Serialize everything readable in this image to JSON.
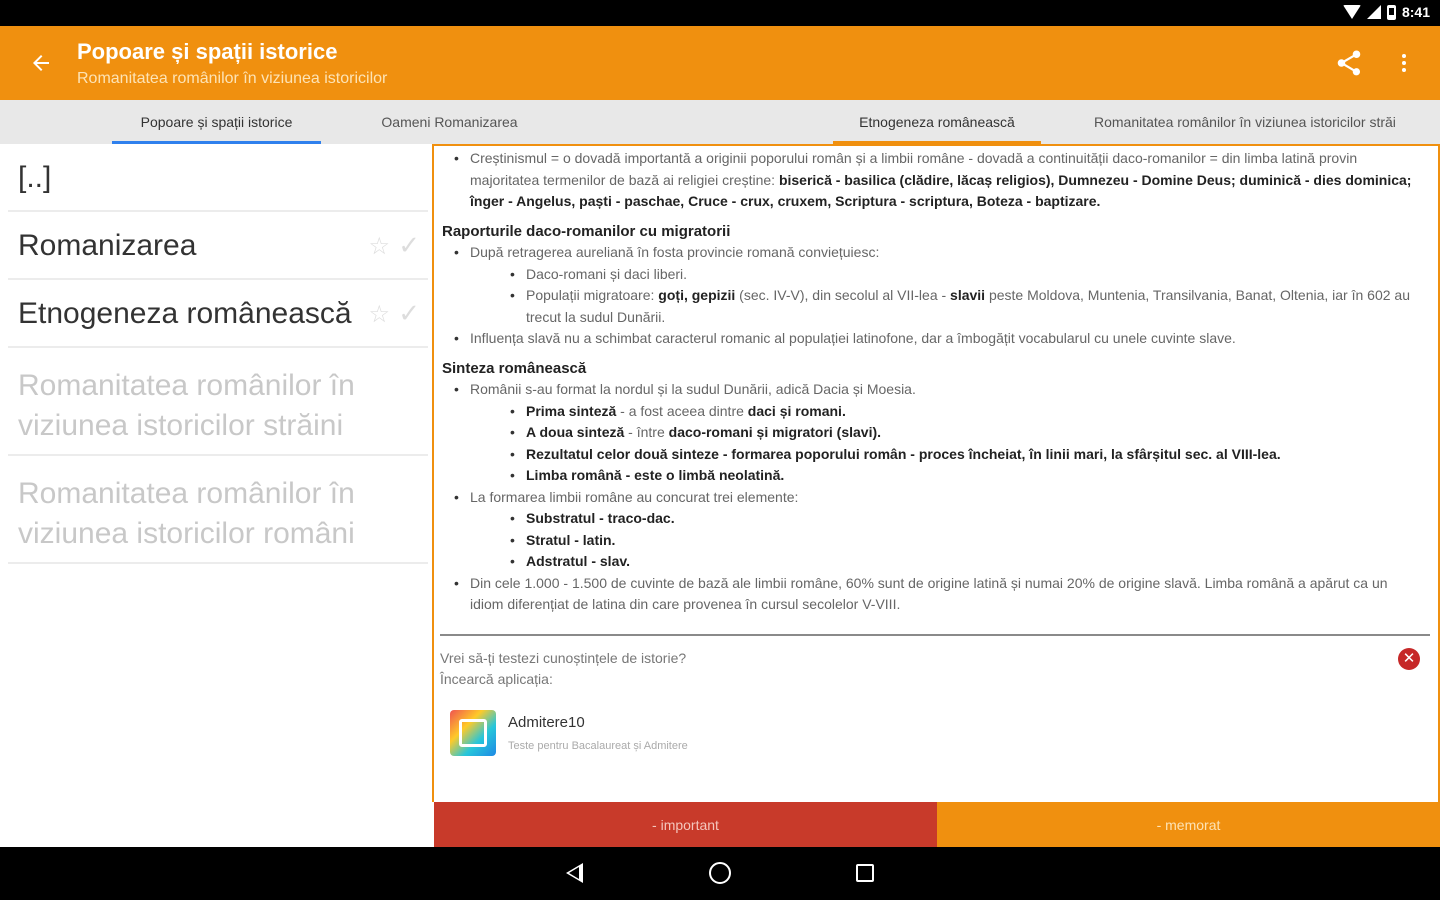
{
  "status_bar": {
    "time": "8:41"
  },
  "app_bar": {
    "title": "Popoare și spații istorice",
    "subtitle": "Romanitatea românilor în viziunea istoricilor",
    "accent_color": "#f0900f",
    "back_icon": "arrow-left-icon",
    "share_icon": "share-icon",
    "more_icon": "more-vert-icon"
  },
  "tabs": [
    {
      "label": "Popoare și spații istorice",
      "active": true,
      "indicator_color": "#2f80ed"
    },
    {
      "label": "Oameni Romanizarea",
      "active": false
    },
    {
      "label": "Etnogeneza românească",
      "active": true,
      "indicator_color": "#f0900f"
    },
    {
      "label": "Romanitatea românilor în viziunea istoricilor străi",
      "active": false
    }
  ],
  "list": {
    "items": [
      {
        "label": "[..]",
        "disabled": false
      },
      {
        "label": "Romanizarea",
        "disabled": false
      },
      {
        "label": "Etnogeneza românească",
        "disabled": false
      },
      {
        "label_line1": "Romanitatea românilor în",
        "label_line2": "viziunea istoricilor străini",
        "disabled": true
      },
      {
        "label_line1": "Romanitatea românilor în",
        "label_line2": "viziunea istoricilor români",
        "disabled": true
      }
    ]
  },
  "article": {
    "b1": {
      "t1": "Creștinismul = o dovadă importantă a originii poporului român și a limbii române - dovadă a continuității daco-romanilor = din limba latină provin majoritatea termenilor de bază ai religiei creștine: ",
      "b1": "biserică - basilica (clădire, lăcaș religios), Dumnezeu - Domine Deus; duminică - dies dominica; înger - Angelus, paști - paschae, Cruce - crux, cruxem, Scriptura - scriptura, Boteza - baptizare."
    },
    "h_rap": "Raporturile daco-romanilor cu migratorii",
    "r1": "După retragerea aureliană în fosta provincie romană conviețuiesc:",
    "r1a": "Daco-romani și daci liberi.",
    "r1b": {
      "t1": "Populații migratoare: ",
      "b1": "goți, gepizii",
      "t2": " (sec. IV-V), din secolul al VII-lea - ",
      "b2": "slavii",
      "t3": " peste Moldova, Muntenia, Transilvania, Banat, Oltenia, iar în 602 au trecut la sudul Dunării."
    },
    "r2": "Influența slavă nu a schimbat caracterul romanic al populației latinofone, dar a îmbogățit vocabularul cu unele cuvinte slave.",
    "h_sin": "Sinteza românească",
    "s1": "Românii s-au format la nordul și la sudul Dunării, adică Dacia și Moesia.",
    "s1a": {
      "b1": "Prima sinteză",
      "t1": " - a fost aceea dintre ",
      "b2": "daci și romani."
    },
    "s1b": {
      "b1": "A doua sinteză",
      "t1": " - între ",
      "b2": "daco-romani și migratori (slavi)."
    },
    "s1c": "Rezultatul celor două sinteze - formarea poporului român - proces încheiat, în linii mari, la sfârșitul sec. al VIII-lea.",
    "s1d": "Limba română - este o limbă neolatină.",
    "s2": "La formarea limbii române au concurat trei elemente:",
    "s2a": "Substratul - traco-dac.",
    "s2b": "Stratul - latin.",
    "s2c": "Adstratul - slav.",
    "s3": "Din cele 1.000 - 1.500 de cuvinte de bază ale limbii române, 60% sunt de origine latină și numai 20% de origine slavă. Limba română a apărut ca un idiom diferențiat de latina din care provenea în cursul secolelor V-VIII."
  },
  "promo": {
    "line1": "Vrei să-ți testezi cunoștințele de istorie?",
    "line2": "Încearcă aplicația:",
    "close_icon": "close-circle-icon",
    "app_name": "Admitere10",
    "app_desc": "Teste pentru Bacalaureat și Admitere",
    "app_icon": "admitere-app-icon"
  },
  "buttons": {
    "important_label": "- important",
    "important_color": "#c83a2a",
    "memorat_label": "- memorat",
    "memorat_color": "#f0900f"
  },
  "nav_bar": {
    "back_icon": "nav-back-icon",
    "home_icon": "nav-home-icon",
    "recent_icon": "nav-recent-icon"
  }
}
